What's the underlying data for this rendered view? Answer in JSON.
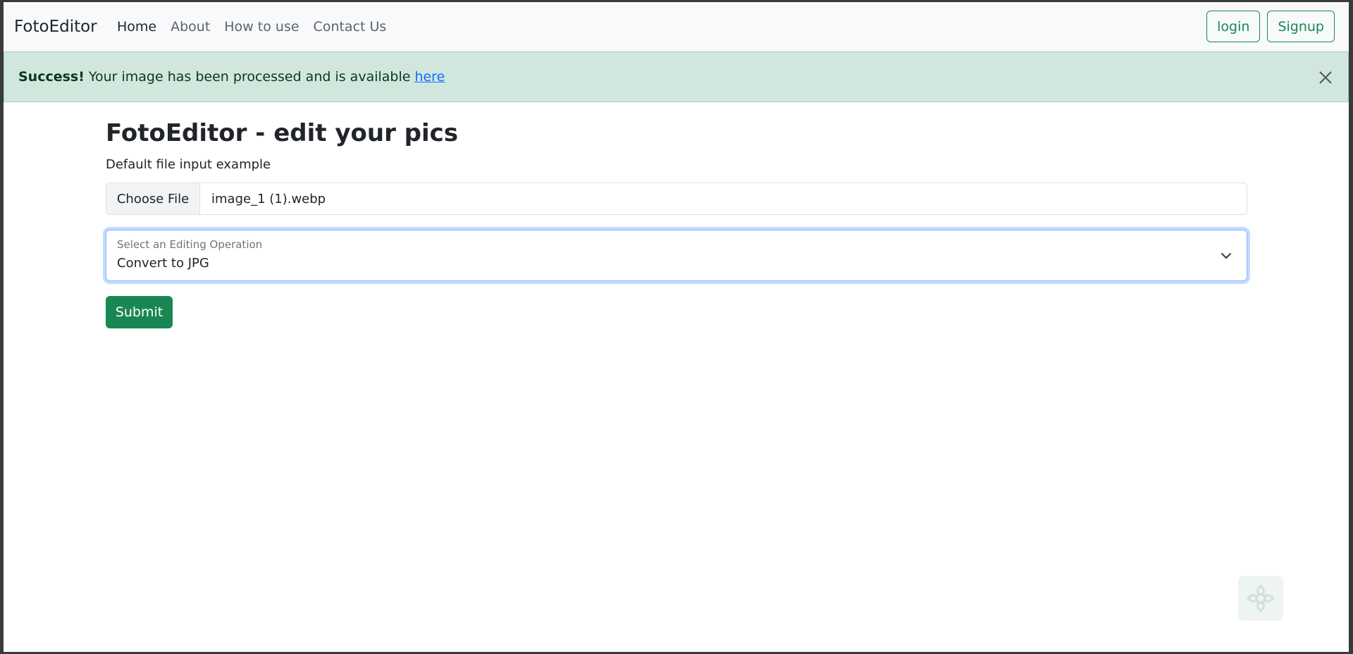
{
  "navbar": {
    "brand": "FotoEditor",
    "links": [
      {
        "label": "Home",
        "active": true
      },
      {
        "label": "About",
        "active": false
      },
      {
        "label": "How to use",
        "active": false
      },
      {
        "label": "Contact Us",
        "active": false
      }
    ],
    "login_label": "login",
    "signup_label": "Signup"
  },
  "alert": {
    "strong": "Success!",
    "message": "Your image has been processed and is available",
    "link_text": "here",
    "close_icon": "close-icon"
  },
  "main": {
    "title": "FotoEditor - edit your pics",
    "file_label": "Default file input example",
    "file_button": "Choose File",
    "file_name": "image_1 (1).webp",
    "select_label": "Select an Editing Operation",
    "select_value": "Convert to JPG",
    "submit_label": "Submit"
  },
  "colors": {
    "accent": "#198754",
    "alert_bg": "#d1e7dd",
    "link": "#0d6efd",
    "focus_border": "#86b7fe"
  }
}
